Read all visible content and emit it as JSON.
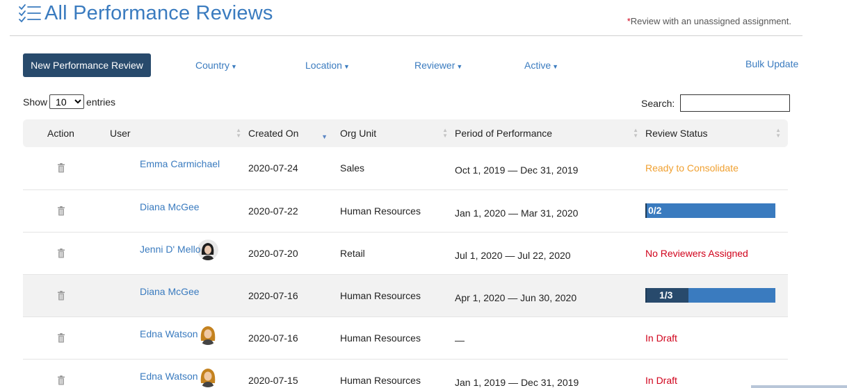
{
  "header": {
    "title": "All Performance Reviews",
    "note_star": "*",
    "note_text": "Review with an unassigned assignment."
  },
  "toolbar": {
    "new_review_label": "New Performance Review",
    "filters": [
      {
        "label": "Country"
      },
      {
        "label": "Location"
      },
      {
        "label": "Reviewer"
      },
      {
        "label": "Active"
      }
    ],
    "bulk_update_label": "Bulk Update"
  },
  "table_controls": {
    "show_label": "Show",
    "entries_value": "10",
    "entries_label": "entries",
    "search_label": "Search:",
    "search_value": ""
  },
  "table": {
    "columns": [
      "Action",
      "User",
      "Created On",
      "Org Unit",
      "Period of Performance",
      "Review Status"
    ],
    "rows": [
      {
        "user": "Emma Carmichael",
        "created": "2020-07-24",
        "org": "Sales",
        "period": "Oct 1, 2019 — Dec 31, 2019",
        "status": "Ready to Consolidate",
        "status_type": "text-orange",
        "avatar": "none"
      },
      {
        "user": "Diana McGee",
        "created": "2020-07-22",
        "org": "Human Resources",
        "period": "Jan 1, 2020 — Mar 31, 2020",
        "status": "0/2",
        "status_type": "progress",
        "progress": 0.0
      },
      {
        "user": "Jenni D' Mello",
        "created": "2020-07-20",
        "org": "Retail",
        "period": "Jul 1, 2020 — Jul 22, 2020",
        "status": "No Reviewers Assigned",
        "status_type": "text-red",
        "avatar": "dark-hair"
      },
      {
        "user": "Diana McGee",
        "created": "2020-07-16",
        "org": "Human Resources",
        "period": "Apr 1, 2020 — Jun 30, 2020",
        "status": "1/3",
        "status_type": "progress",
        "progress": 0.333
      },
      {
        "user": "Edna Watson",
        "created": "2020-07-16",
        "org": "Human Resources",
        "period": "—",
        "status": "In Draft",
        "status_type": "text-red",
        "avatar": "blonde-hair"
      },
      {
        "user": "Edna Watson",
        "created": "2020-07-15",
        "org": "Human Resources",
        "period": "Jan 1, 2019 — Dec 31, 2019",
        "status": "In Draft",
        "status_type": "text-red",
        "avatar": "blonde-hair"
      }
    ]
  },
  "colors": {
    "accent": "#3a7bbf",
    "button_dark": "#284a6c",
    "status_orange": "#f0a030",
    "status_red": "#d0021b"
  },
  "icons": {
    "title": "checklist-icon",
    "action": "trash-icon",
    "filter": "caret-down-icon",
    "sort": "sort-icon"
  }
}
